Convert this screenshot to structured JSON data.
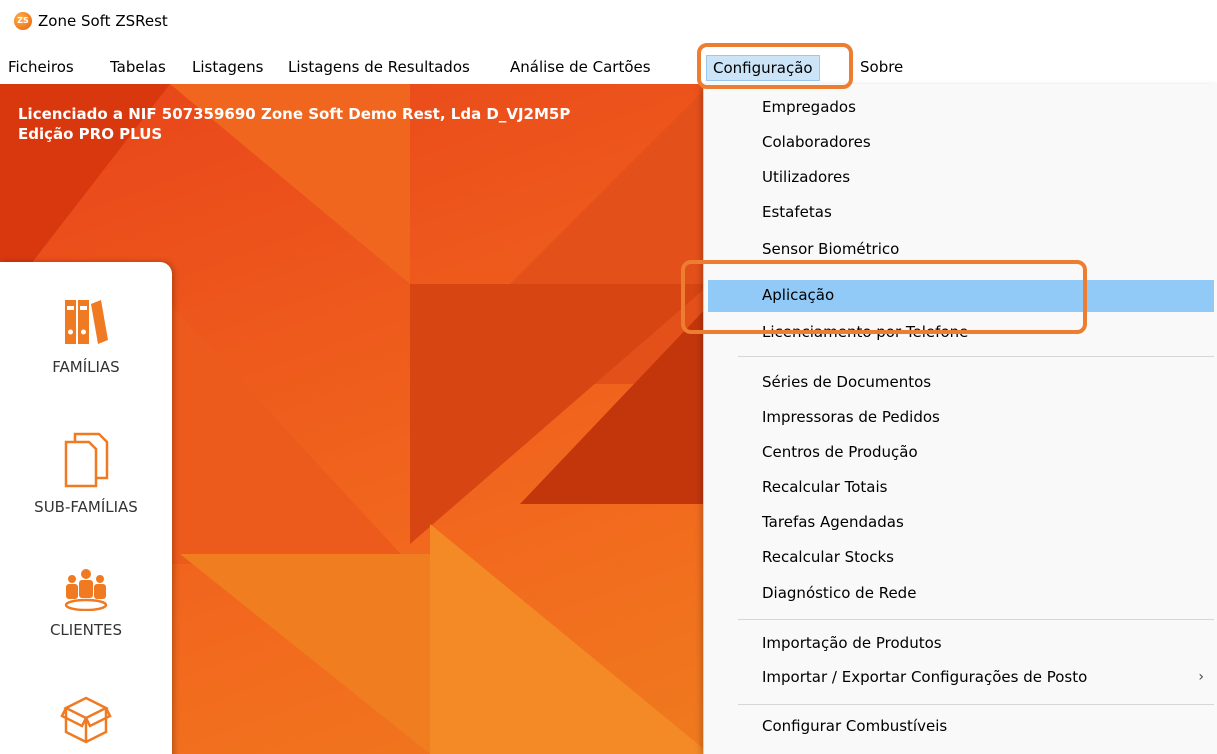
{
  "window": {
    "title": "Zone Soft ZSRest",
    "icon": "zs-app-icon",
    "icon_text": "ZS"
  },
  "menubar": {
    "items": [
      "Ficheiros",
      "Tabelas",
      "Listagens",
      "Listagens de Resultados",
      "Análise de Cartões",
      "Configuração",
      "Sobre"
    ],
    "active": "Configuração"
  },
  "license": {
    "line1": "Licenciado a NIF 507359690 Zone Soft Demo Rest, Lda D_VJ2M5P",
    "line2": "Edição PRO PLUS"
  },
  "sidebar": {
    "items": [
      {
        "label": "FAMÍLIAS",
        "icon": "binders-icon"
      },
      {
        "label": "SUB-FAMÍLIAS",
        "icon": "documents-icon"
      },
      {
        "label": "CLIENTES",
        "icon": "people-icon"
      },
      {
        "label": "",
        "icon": "box-icon"
      }
    ]
  },
  "dropdown": {
    "items": [
      "Empregados",
      "Colaboradores",
      "Utilizadores",
      "Estafetas",
      "Sensor Biométrico",
      "Aplicação",
      "Licenciamento por Telefone",
      "Séries de Documentos",
      "Impressoras de Pedidos",
      "Centros de Produção",
      "Recalcular Totais",
      "Tarefas Agendadas",
      "Recalcular Stocks",
      "Diagnóstico de Rede",
      "Importação de Produtos",
      "Importar / Exportar Configurações de Posto",
      "Configurar Combustíveis"
    ],
    "highlighted": "Aplicação",
    "submenu_item": "Importar / Exportar Configurações de Posto",
    "submenu_arrow": "›"
  },
  "colors": {
    "highlight": "#ed7d31",
    "hover": "#91c9f7",
    "brand": "#e85d0c"
  }
}
